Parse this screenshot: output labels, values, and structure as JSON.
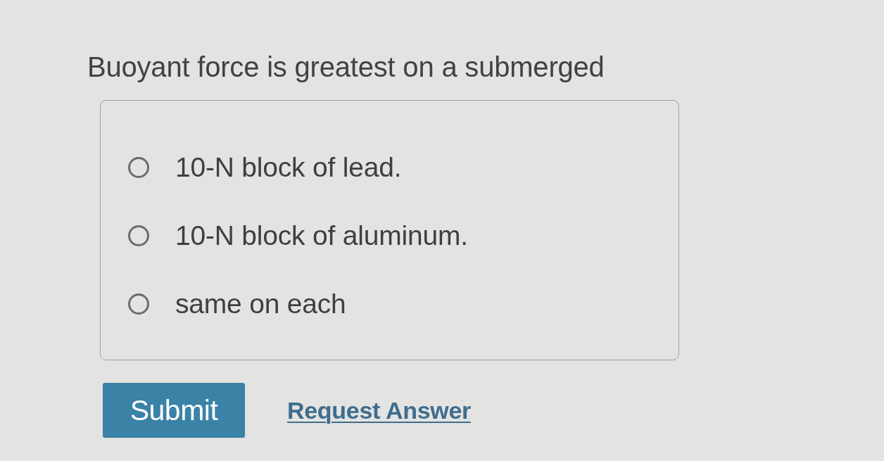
{
  "question": {
    "text": "Buoyant force is greatest on a submerged"
  },
  "options": [
    {
      "label": "10-N block of lead.",
      "selected": false
    },
    {
      "label": "10-N block of aluminum.",
      "selected": false
    },
    {
      "label": "same on each",
      "selected": false
    }
  ],
  "actions": [
    {
      "kind": "button",
      "label": "Submit"
    },
    {
      "kind": "link",
      "label": "Request Answer"
    }
  ]
}
